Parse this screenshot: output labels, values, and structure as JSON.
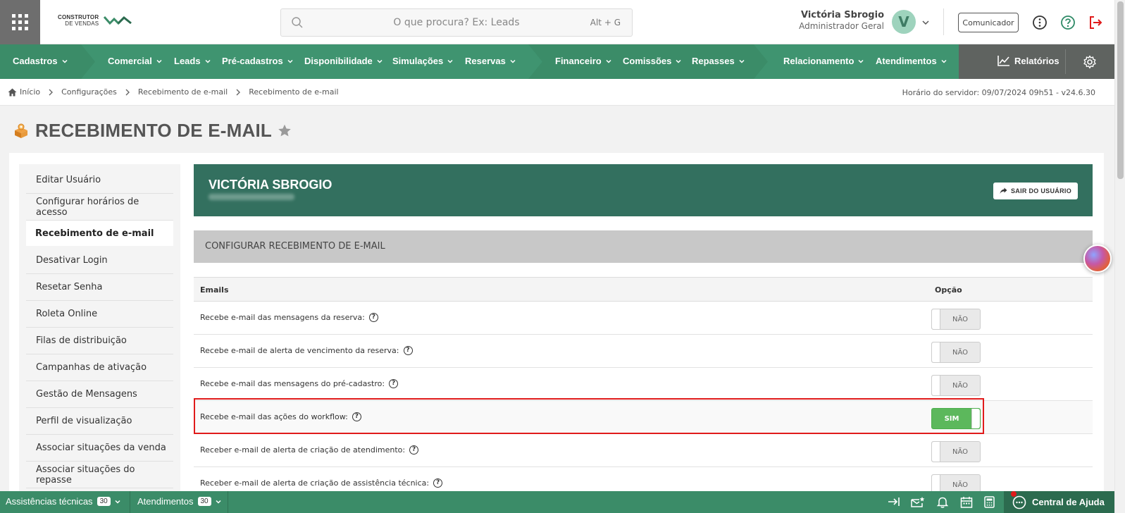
{
  "header": {
    "logo_line1": "CONSTRUTOR",
    "logo_line2": "DE VENDAS",
    "search_placeholder": "O que procura? Ex: Leads",
    "search_shortcut": "Alt + G",
    "user_name": "Victória Sbrogio",
    "user_role": "Administrador Geral",
    "avatar_letter": "V",
    "comunicador_label": "Comunicador"
  },
  "nav": {
    "items": [
      "Cadastros",
      "Comercial",
      "Leads",
      "Pré-cadastros",
      "Disponibilidade",
      "Simulações",
      "Reservas",
      "Financeiro",
      "Comissões",
      "Repasses",
      "Relacionamento",
      "Atendimentos"
    ],
    "reports_label": "Relatórios",
    "colors": {
      "nav_green": "#3b8c68",
      "nav_dark": "#5f6360"
    }
  },
  "breadcrumb": {
    "items": [
      "Início",
      "Configurações",
      "Recebimento de e-mail",
      "Recebimento de e-mail"
    ],
    "server_time": "Horário do servidor: 09/07/2024 09h51 - v24.6.30"
  },
  "page": {
    "title": "RECEBIMENTO DE E-MAIL"
  },
  "sidebar": {
    "items": [
      {
        "label": "Editar Usuário",
        "active": false
      },
      {
        "label": "Configurar horários de acesso",
        "active": false
      },
      {
        "label": "Recebimento de e-mail",
        "active": true
      },
      {
        "label": "Desativar Login",
        "active": false
      },
      {
        "label": "Resetar Senha",
        "active": false
      },
      {
        "label": "Roleta Online",
        "active": false
      },
      {
        "label": "Filas de distribuição",
        "active": false
      },
      {
        "label": "Campanhas de ativação",
        "active": false
      },
      {
        "label": "Gestão de Mensagens",
        "active": false
      },
      {
        "label": "Perfil de visualização",
        "active": false
      },
      {
        "label": "Associar situações da venda",
        "active": false
      },
      {
        "label": "Associar situações do repasse",
        "active": false
      }
    ]
  },
  "user_banner": {
    "name": "VICTÓRIA SBROGIO",
    "logout_label": "SAIR DO USUÁRIO"
  },
  "config": {
    "title": "CONFIGURAR RECEBIMENTO DE E-MAIL",
    "col_emails": "Emails",
    "col_option": "Opção",
    "help_glyph": "?",
    "rows": [
      {
        "label": "Recebe e-mail das mensagens da reserva:",
        "state": "NÃO",
        "on": false
      },
      {
        "label": "Recebe e-mail de alerta de vencimento da reserva:",
        "state": "NÃO",
        "on": false
      },
      {
        "label": "Recebe e-mail das mensagens do pré-cadastro:",
        "state": "NÃO",
        "on": false
      },
      {
        "label": "Recebe e-mail das ações do workflow:",
        "state": "SIM",
        "on": true
      },
      {
        "label": "Receber e-mail de alerta de criação de atendimento:",
        "state": "NÃO",
        "on": false
      },
      {
        "label": "Receber e-mail de alerta de criação de assistência técnica:",
        "state": "NÃO",
        "on": false
      }
    ]
  },
  "bottombar": {
    "assist_label": "Assistências técnicas",
    "assist_count": "30",
    "atend_label": "Atendimentos",
    "atend_count": "30",
    "help_center_label": "Central de Ajuda"
  }
}
